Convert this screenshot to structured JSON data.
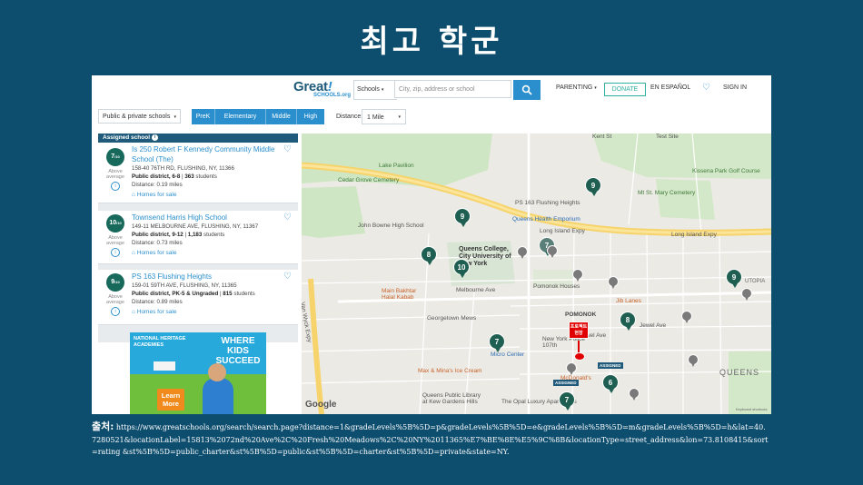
{
  "slide": {
    "title": "최고 학군",
    "source_label": "출처",
    "source_url": "https://www.greatschools.org/search/search.page?distance=1&gradeLevels%5B%5D=p&gradeLevels%5B%5D=e&gradeLevels%5B%5D=m&gradeLevels%5B%5D=h&lat=40.7280521&locationLabel=15813%2072nd%20Ave%2C%20Fresh%20Meadows%2C%20NY%2011365%E7%BE%8E%E5%9C%8B&locationType=street_address&lon=73.8108415&sort=rating &st%5B%5D=public_charter&st%5B%5D=public&st%5B%5D=charter&st%5B%5D=private&state=NY."
  },
  "header": {
    "logo_text": "Great",
    "logo_mark": "!",
    "logo_sub": "SCHOOLS.org",
    "search_type": "Schools",
    "search_placeholder": "City, zip, address or school",
    "nav": {
      "parenting": "PARENTING",
      "donate": "DONATE",
      "espanol": "EN ESPAÑOL",
      "signin": "SIGN IN"
    }
  },
  "filters": {
    "type_select": "Public & private schools",
    "grades": [
      "PreK",
      "Elementary",
      "Middle",
      "High"
    ],
    "distance_label": "Distance:",
    "distance_value": "1 Mile"
  },
  "list": {
    "assigned_label": "Assigned school",
    "schools": [
      {
        "rating": "7",
        "rating_note": "Above average",
        "name": "Is 250 Robert F Kennedy Community Middle School (The)",
        "address": "158-40 76TH RD, FLUSHING, NY, 11366",
        "district": "Public district, 6-8",
        "students": "363",
        "students_label": "students",
        "distance": "Distance: 0.19 miles",
        "homes": "Homes for sale"
      },
      {
        "rating": "10",
        "rating_note": "Above average",
        "name": "Townsend Harris High School",
        "address": "149-11 MELBOURNE AVE, FLUSHING, NY, 11367",
        "district": "Public district, 9-12",
        "students": "1,183",
        "students_label": "students",
        "distance": "Distance: 0.73 miles",
        "homes": "Homes for sale"
      },
      {
        "rating": "9",
        "rating_note": "Above average",
        "name": "PS 163 Flushing Heights",
        "address": "159-01 59TH AVE, FLUSHING, NY, 11365",
        "district": "Public district, PK-5 & Ungraded",
        "students": "815",
        "students_label": "students",
        "distance": "Distance: 0.89 miles",
        "homes": "Homes for sale"
      }
    ]
  },
  "ad": {
    "brand": "NATIONAL HERITAGE ACADEMIES",
    "headline": "WHERE KIDS SUCCEED",
    "cta": "Learn More"
  },
  "map": {
    "labels": {
      "lake_pavilion": "Lake Pavilion",
      "cedar_grove": "Cedar Grove Cemetery",
      "john_bowne": "John Bowne High School",
      "ps163": "PS 163 Flushing Heights",
      "queens_health": "Queens Health Emporium",
      "queens_college": "Queens College, City University of New York",
      "lie_left": "Long Island Expy",
      "lie_right": "Long Island Expy",
      "mt_st_mary": "Mt St. Mary Cemetery",
      "kissena": "Kissena Park Golf Course",
      "pomonok_houses": "Pomonok Houses",
      "main_bakhtar": "Main Bakhtar Halal Kabab",
      "melbourne": "Melbourne Ave",
      "georgetown": "Georgetown Mews",
      "pomonok": "POMONOK",
      "jib_lanes": "Jib Lanes",
      "jewel1": "Jewel Ave",
      "jewel2": "Jewel Ave",
      "nypd": "New York Police 107th",
      "micro": "Micro Center",
      "maxminas": "Max & Mina's Ice Cream",
      "mcdonalds": "McDonald's",
      "queens_library": "Queens Public Library at Kew Gardens Hills",
      "opal": "The Opal Luxury Apartments",
      "queens": "QUEENS",
      "utopia": "UTOPIA",
      "vanwyck": "Van Wyck Expy",
      "kent_st": "Kent St",
      "test_site": "Test Site",
      "google": "Google",
      "keyboard": "Keyboard shortcuts"
    },
    "pins": [
      "9",
      "9",
      "8",
      "10",
      "7",
      "8",
      "9",
      "7",
      "6",
      "7"
    ],
    "assigned_tag": "ASSIGNED",
    "project_label": "프로젝트 현장"
  }
}
